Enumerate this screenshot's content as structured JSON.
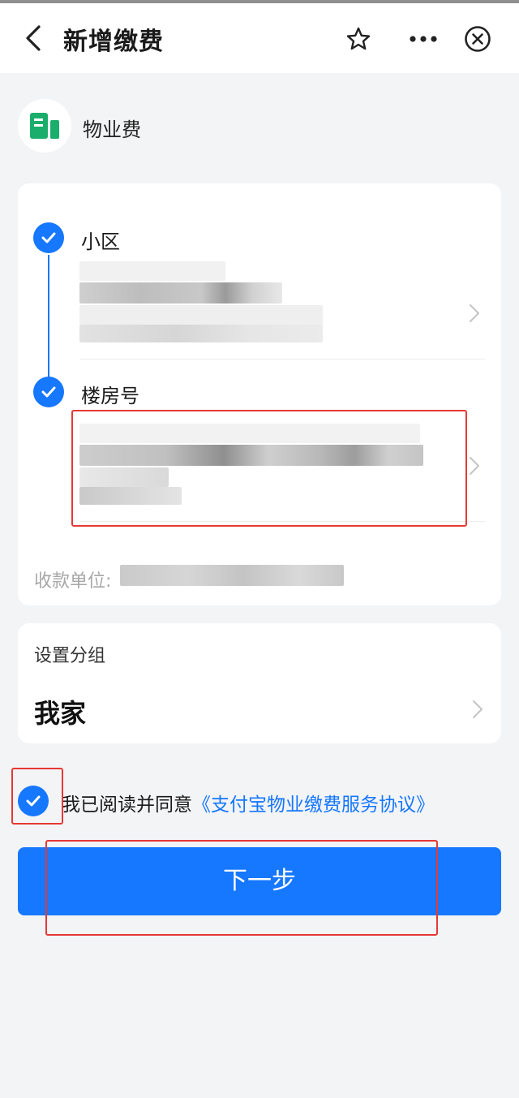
{
  "navbar": {
    "title": "新增缴费",
    "icons": [
      "back-arrow-icon",
      "star-icon",
      "more-dots-icon",
      "close-circle-icon"
    ]
  },
  "biller": {
    "name": "物业费",
    "icon": "building-icon",
    "icon_color": "#1aad6b"
  },
  "form": {
    "community_label": "小区",
    "building_label": "楼房号",
    "payee_label": "收款单位:"
  },
  "group": {
    "label": "设置分组",
    "value": "我家"
  },
  "agreement": {
    "prefix": "我已阅读并同意",
    "link": "《支付宝物业缴费服务协议》",
    "checked": true
  },
  "next_button": "下一步",
  "colors": {
    "accent": "#1677ff",
    "highlight_box": "#e53935",
    "background": "#f3f4f6"
  }
}
